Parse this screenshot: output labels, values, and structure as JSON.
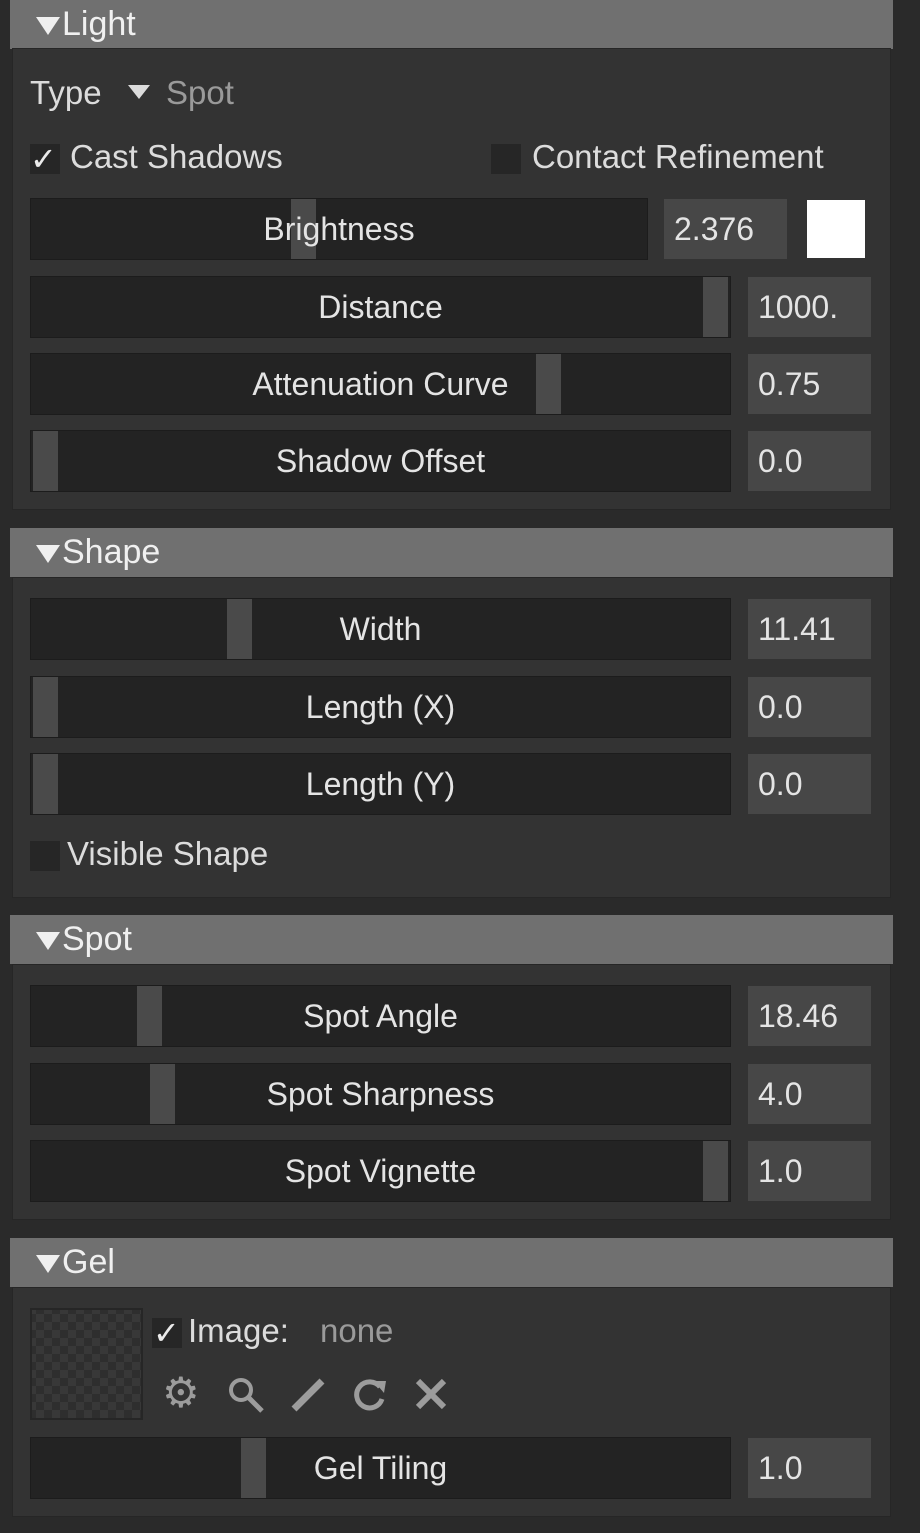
{
  "light": {
    "title": "Light",
    "type_label": "Type",
    "type_value": "Spot",
    "cast_shadows": {
      "label": "Cast Shadows",
      "checked": true
    },
    "contact_refinement": {
      "label": "Contact Refinement",
      "checked": false
    },
    "brightness": {
      "label": "Brightness",
      "value": "2.376",
      "level": 0.44
    },
    "color_swatch": "#ffffff",
    "distance": {
      "label": "Distance",
      "value": "1000.",
      "level": 1.0
    },
    "attenuation_curve": {
      "label": "Attenuation Curve",
      "value": "0.75",
      "level": 0.75
    },
    "shadow_offset": {
      "label": "Shadow Offset",
      "value": "0.0",
      "level": 0.0
    }
  },
  "shape": {
    "title": "Shape",
    "width": {
      "label": "Width",
      "value": "11.41",
      "level": 0.29
    },
    "length_x": {
      "label": "Length (X)",
      "value": "0.0",
      "level": 0.0
    },
    "length_y": {
      "label": "Length (Y)",
      "value": "0.0",
      "level": 0.0
    },
    "visible_shape": {
      "label": "Visible Shape",
      "checked": false
    }
  },
  "spot": {
    "title": "Spot",
    "spot_angle": {
      "label": "Spot Angle",
      "value": "18.46",
      "level": 0.155
    },
    "spot_sharpness": {
      "label": "Spot Sharpness",
      "value": "4.0",
      "level": 0.175
    },
    "spot_vignette": {
      "label": "Spot Vignette",
      "value": "1.0",
      "level": 1.0
    }
  },
  "gel": {
    "title": "Gel",
    "image_label": "Image:",
    "image_value": "none",
    "image_checked": true,
    "icons": [
      "gear-icon",
      "search-icon",
      "pencil-icon",
      "reload-icon",
      "close-icon"
    ],
    "gel_tiling": {
      "label": "Gel Tiling",
      "value": "1.0",
      "level": 0.31
    }
  }
}
